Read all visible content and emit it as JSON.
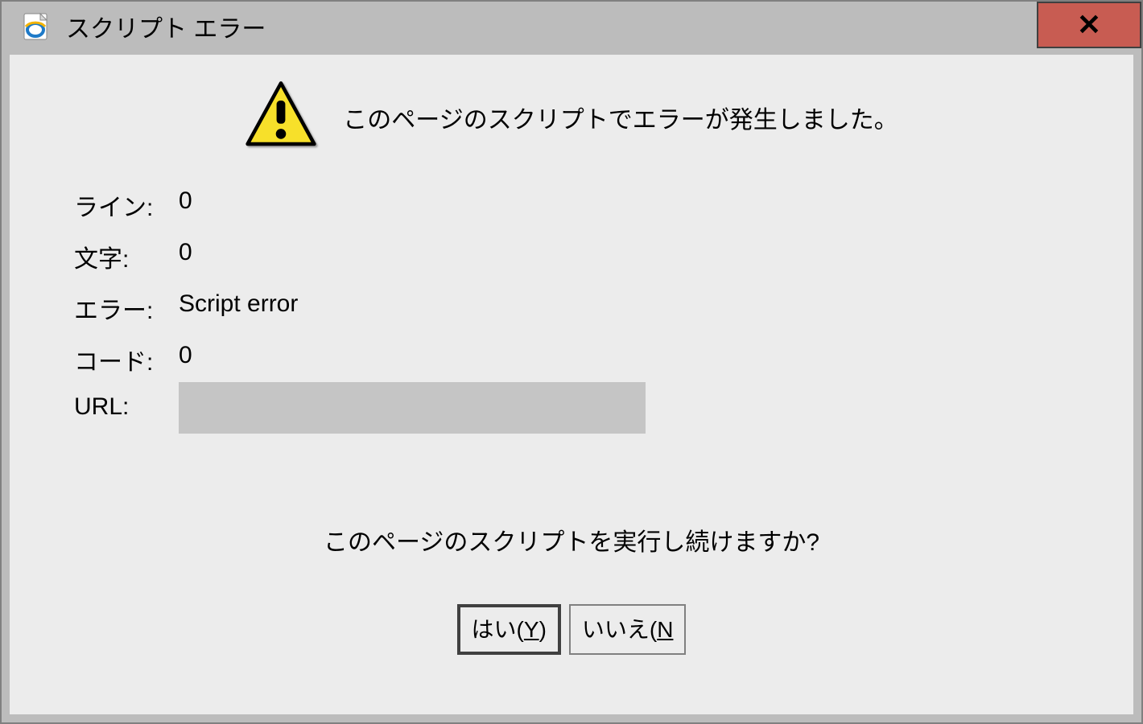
{
  "titlebar": {
    "title": "スクリプト エラー"
  },
  "header": {
    "message": "このページのスクリプトでエラーが発生しました。"
  },
  "fields": {
    "line_label": "ライン:",
    "line_value": "0",
    "char_label": "文字:",
    "char_value": "0",
    "error_label": "エラー:",
    "error_value": "Script error",
    "code_label": "コード:",
    "code_value": "0",
    "url_label": "URL:",
    "url_value": ""
  },
  "question": "このページのスクリプトを実行し続けますか?",
  "buttons": {
    "yes_pre": "はい(",
    "yes_accel": "Y",
    "yes_post": ")",
    "no_pre": "いいえ(",
    "no_accel": "N",
    "no_post": ""
  }
}
